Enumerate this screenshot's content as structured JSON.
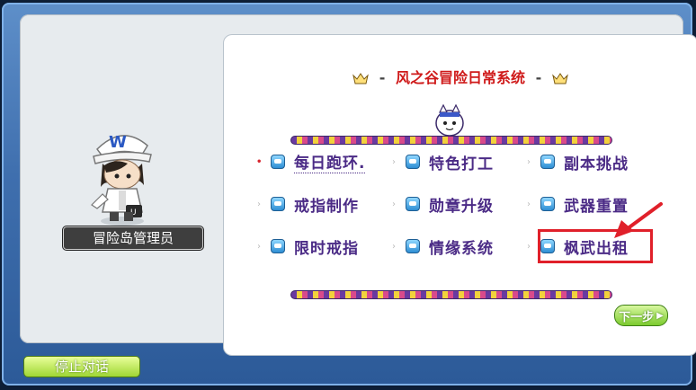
{
  "npc": {
    "name": "冒险岛管理员"
  },
  "panel": {
    "title": "风之谷冒险日常系统",
    "title_dash": "-"
  },
  "menu": {
    "items": [
      {
        "label": "每日跑环.",
        "active": true
      },
      {
        "label": "特色打工"
      },
      {
        "label": "副本挑战"
      },
      {
        "label": "戒指制作"
      },
      {
        "label": "勋章升级"
      },
      {
        "label": "武器重置"
      },
      {
        "label": "限时戒指"
      },
      {
        "label": "情缘系统"
      },
      {
        "label": "枫武出租",
        "highlighted": true
      }
    ]
  },
  "buttons": {
    "next": "下一步",
    "stop": "停止对话"
  },
  "colors": {
    "accent_red": "#e0202a",
    "label_purple": "#4b2b86",
    "title_red": "#cf1a1a",
    "button_green": "#9fd634"
  },
  "icons": {
    "title_decoration": "crown-icon",
    "item_marker": "checkbox-icon",
    "pointer": "arrow-icon"
  }
}
